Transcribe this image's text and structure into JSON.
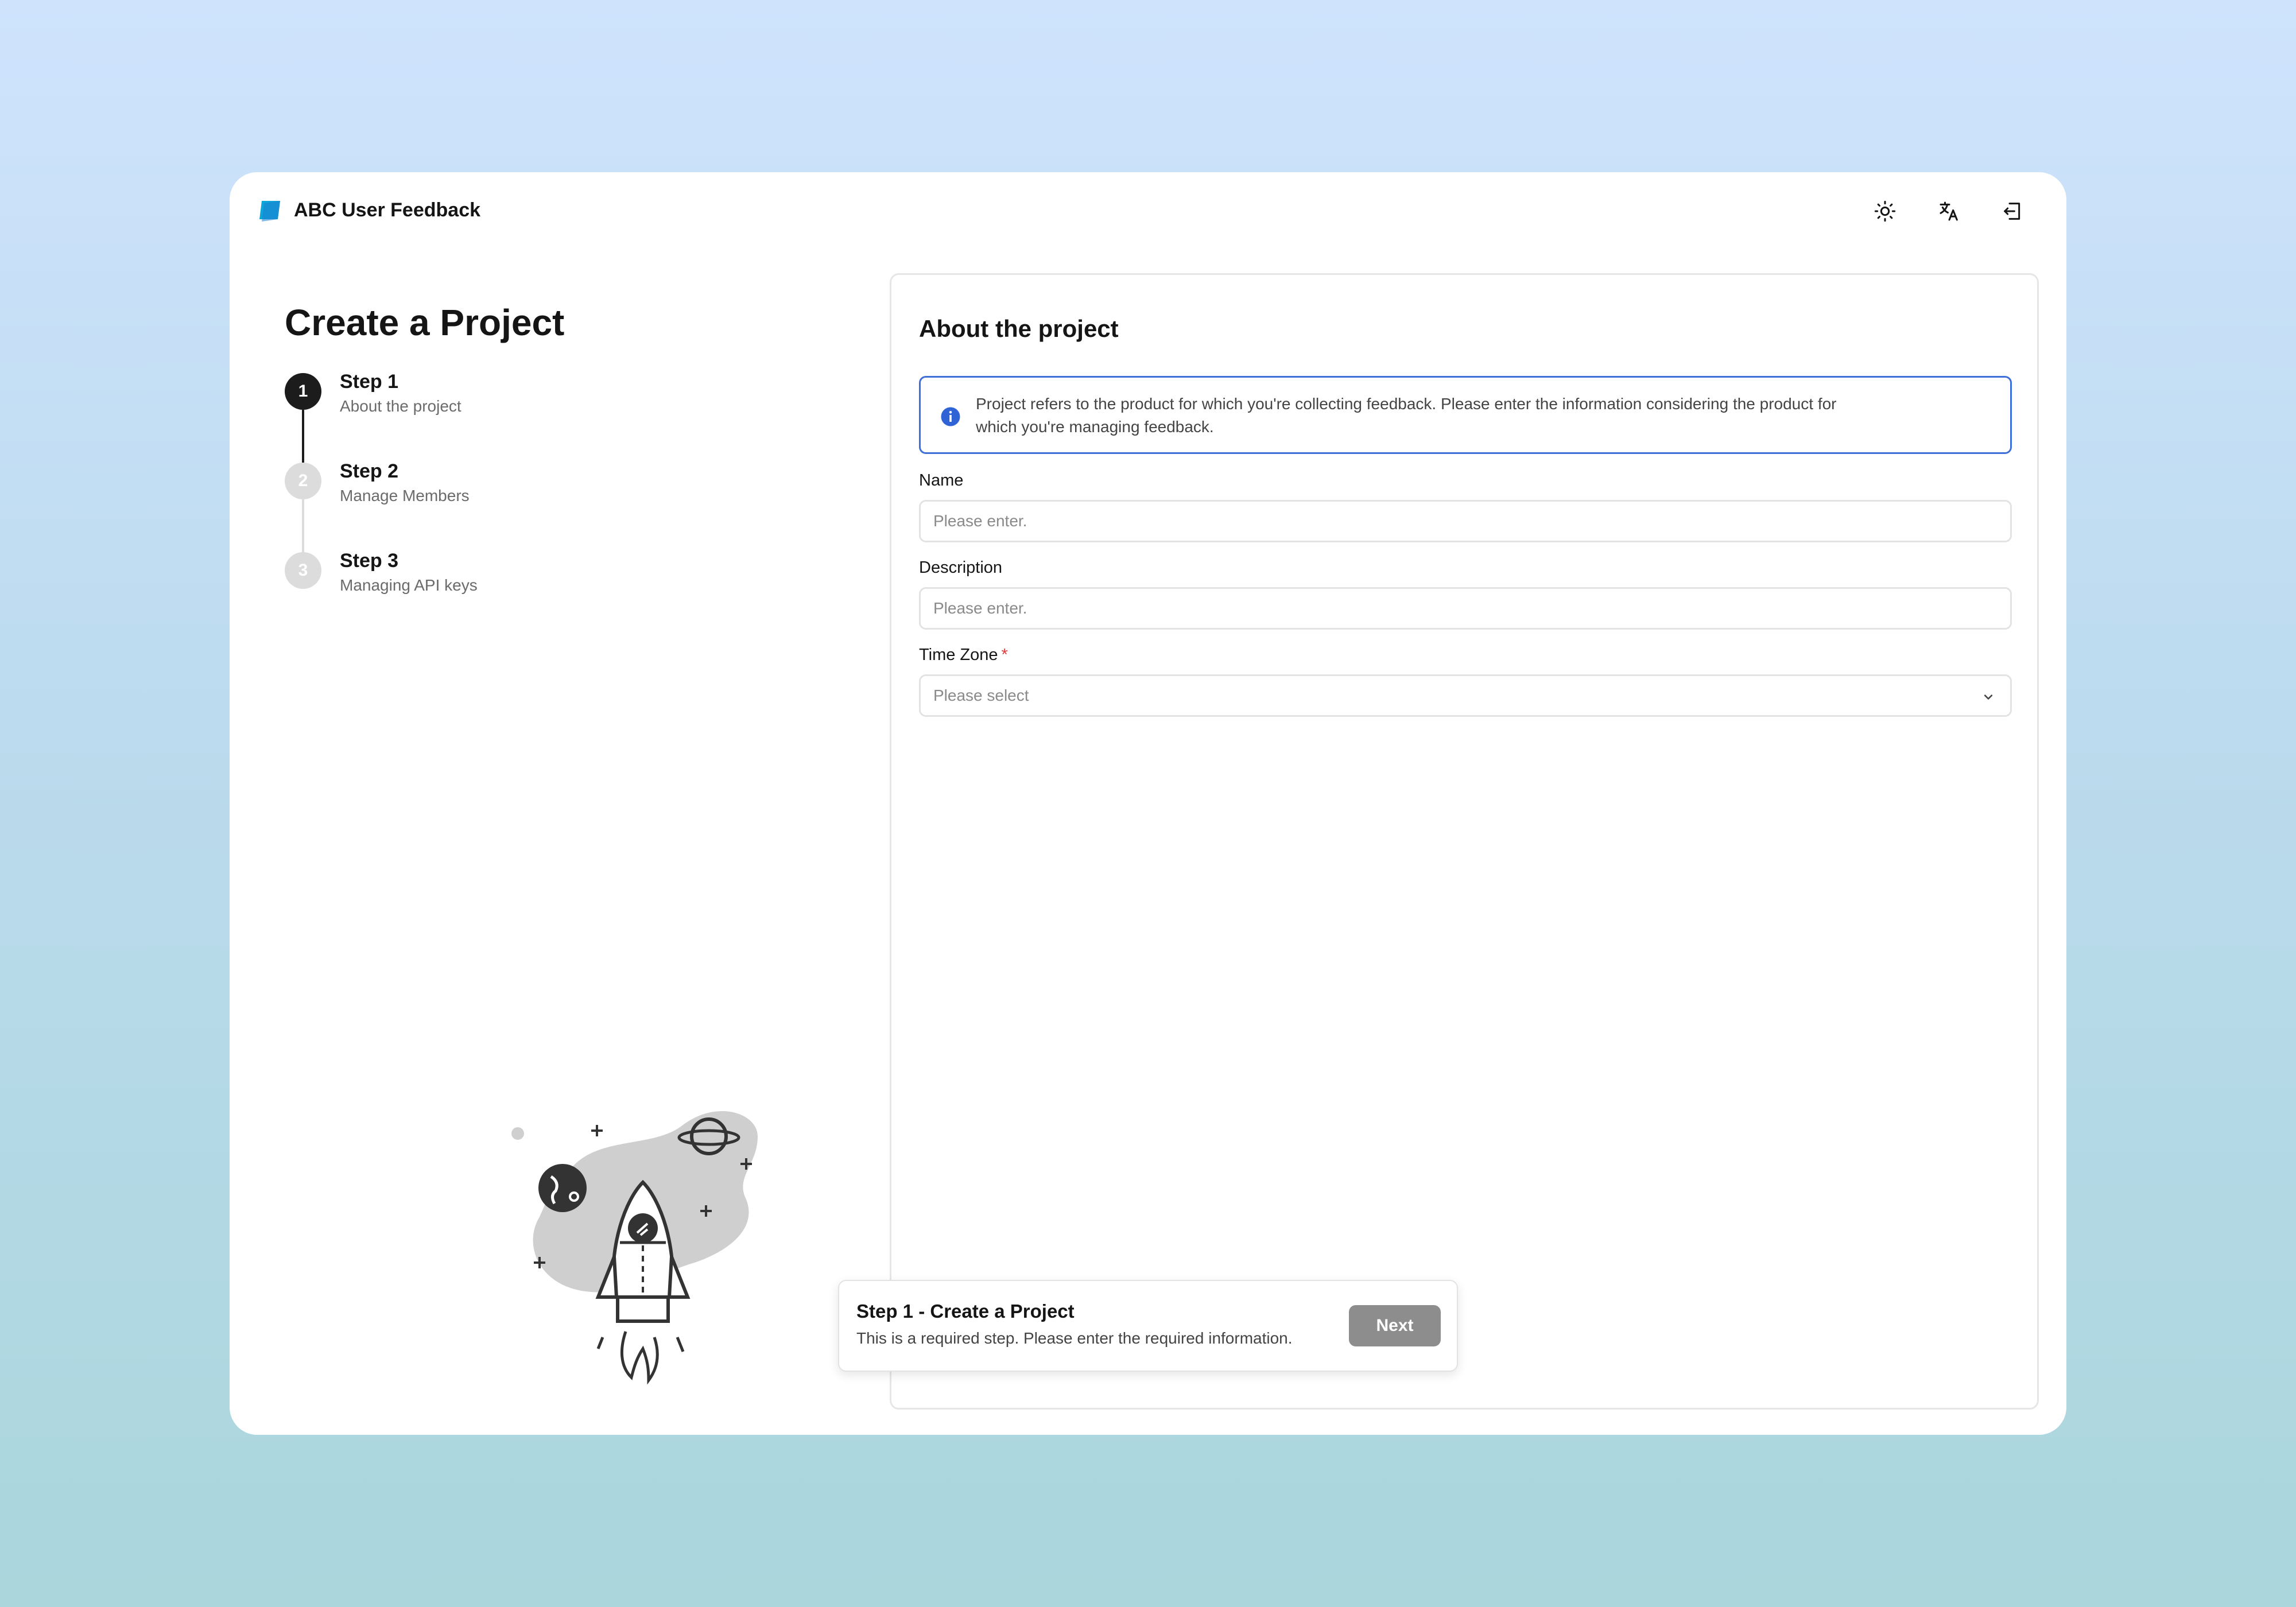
{
  "header": {
    "app_title": "ABC User Feedback",
    "icons": [
      "logo-icon",
      "sun-icon",
      "translate-icon",
      "logout-icon"
    ]
  },
  "page": {
    "title": "Create a Project"
  },
  "steps": [
    {
      "number": "1",
      "title": "Step 1",
      "subtitle": "About the project",
      "state": "active"
    },
    {
      "number": "2",
      "title": "Step 2",
      "subtitle": "Manage Members",
      "state": "inactive"
    },
    {
      "number": "3",
      "title": "Step 3",
      "subtitle": "Managing API keys",
      "state": "inactive"
    }
  ],
  "form": {
    "title": "About the project",
    "info": "Project refers to the product for which you're collecting feedback. Please enter the information considering the product for which you're managing feedback.",
    "name_label": "Name",
    "name_placeholder": "Please enter.",
    "description_label": "Description",
    "description_placeholder": "Please enter.",
    "timezone_label": "Time Zone",
    "timezone_required": "*",
    "timezone_placeholder": "Please select"
  },
  "toast": {
    "title": "Step 1 - Create a Project",
    "subtitle": "This is a required step. Please enter the required information.",
    "next_label": "Next"
  },
  "colors": {
    "accent": "#3e6fd8",
    "step_active": "#1c1c1c",
    "step_inactive": "#dcdcdc",
    "required": "#e03b3b",
    "button_disabled": "#8d8d8d"
  }
}
